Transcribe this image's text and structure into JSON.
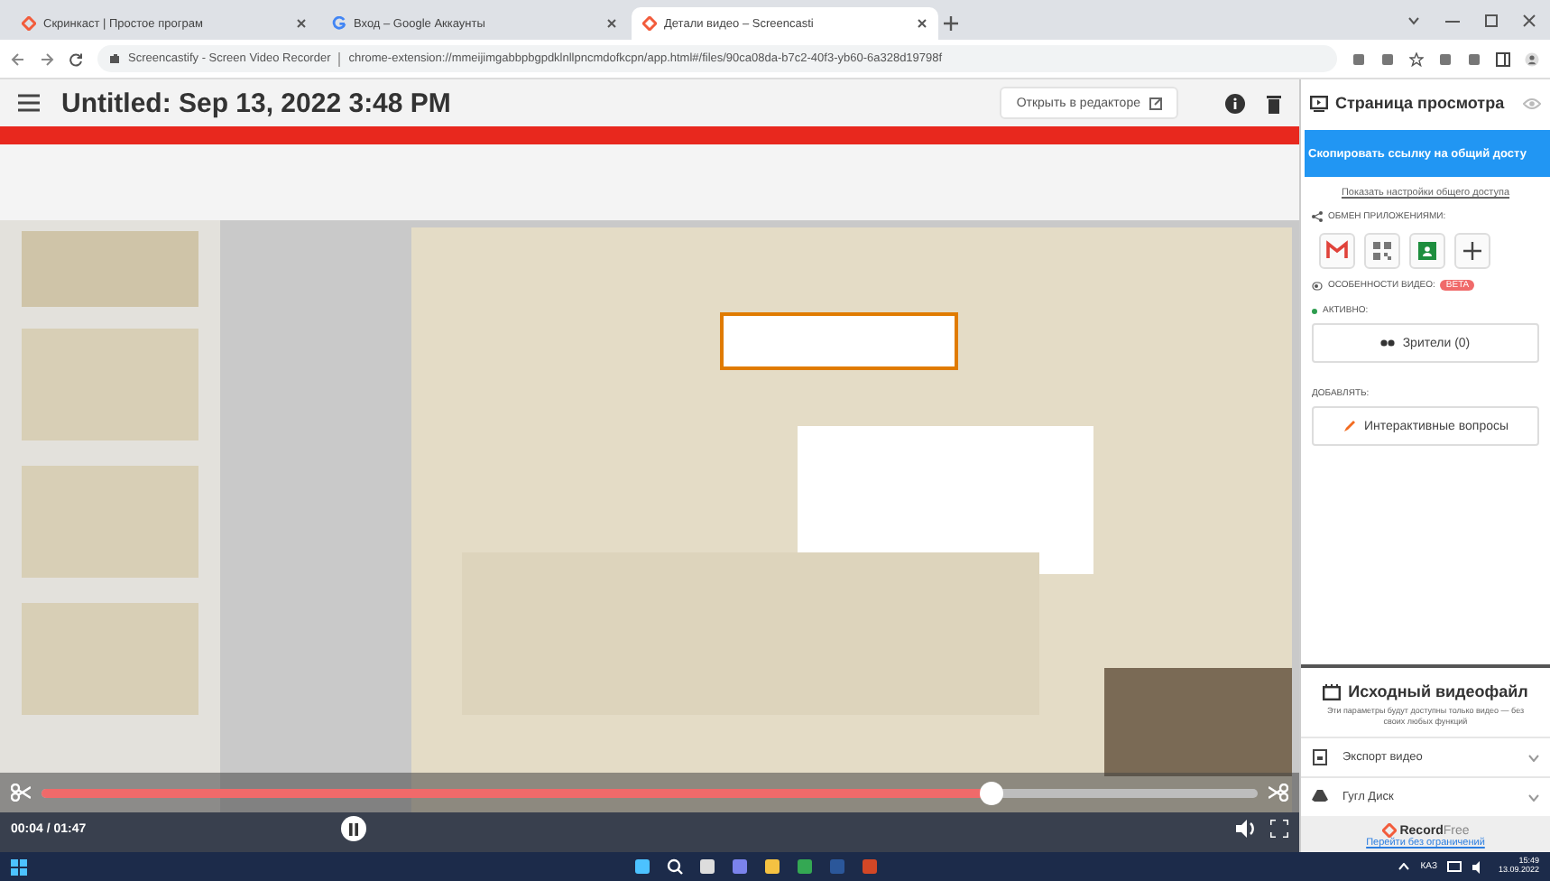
{
  "browser": {
    "tabs": [
      {
        "title": "Скринкаст | Простое програм",
        "kind": "screencastify",
        "selected": false
      },
      {
        "title": "Вход – Google Аккаунты",
        "kind": "google",
        "selected": false
      },
      {
        "title": "Детали видео – Screencasti",
        "kind": "screencastify",
        "selected": true
      }
    ],
    "address": {
      "site": "Screencastify - Screen Video Recorder",
      "url": "chrome-extension://mmeijimgabbpbgpdklnllpncmdofkcpn/app.html#/files/90ca08da-b7c2-40f3-yb60-6a328d19798f"
    }
  },
  "header": {
    "title": "Untitled: Sep 13, 2022 3:48 PM",
    "open_editor": "Открыть в редакторе"
  },
  "player": {
    "progress": {
      "level": 0.78
    },
    "time": "00:04 / 01:47",
    "playing": true
  },
  "share_panel": {
    "title": "Страница просмотра",
    "copy_link": "Скопировать ссылку на общий досту",
    "sharing_settings": "Показать настройки общего доступа",
    "apps_label": "ОБМЕН ПРИЛОЖЕНИЯМИ:",
    "apps": [
      {
        "kind": "gmail"
      },
      {
        "kind": "qr"
      },
      {
        "kind": "classroom"
      },
      {
        "kind": "add"
      }
    ],
    "features_label": "ОСОБЕННОСТИ ВИДЕО:",
    "features_badge": "BETA",
    "active_label": "АКТИВНО:",
    "active": [
      {
        "label": "Зрители (0)",
        "kind": "viewers"
      }
    ],
    "add_label": "ДОБАВЛЯТЬ:",
    "add": [
      {
        "label": "Интерактивные вопросы",
        "kind": "questions"
      }
    ]
  },
  "source_panel": {
    "title": "Исходный видеофайл",
    "note": "Эти параметры будут доступны только видео — без своих любых функций",
    "options": [
      {
        "label": "Экспорт видео",
        "kind": "export"
      },
      {
        "label": "Гугл Диск",
        "kind": "drive"
      }
    ],
    "promo": {
      "brand": "**Record**Free",
      "link": "Перейти без ограничений"
    }
  },
  "taskbar": {
    "language": "КАЗ",
    "time": "15:49",
    "date": "13.09.2022"
  }
}
